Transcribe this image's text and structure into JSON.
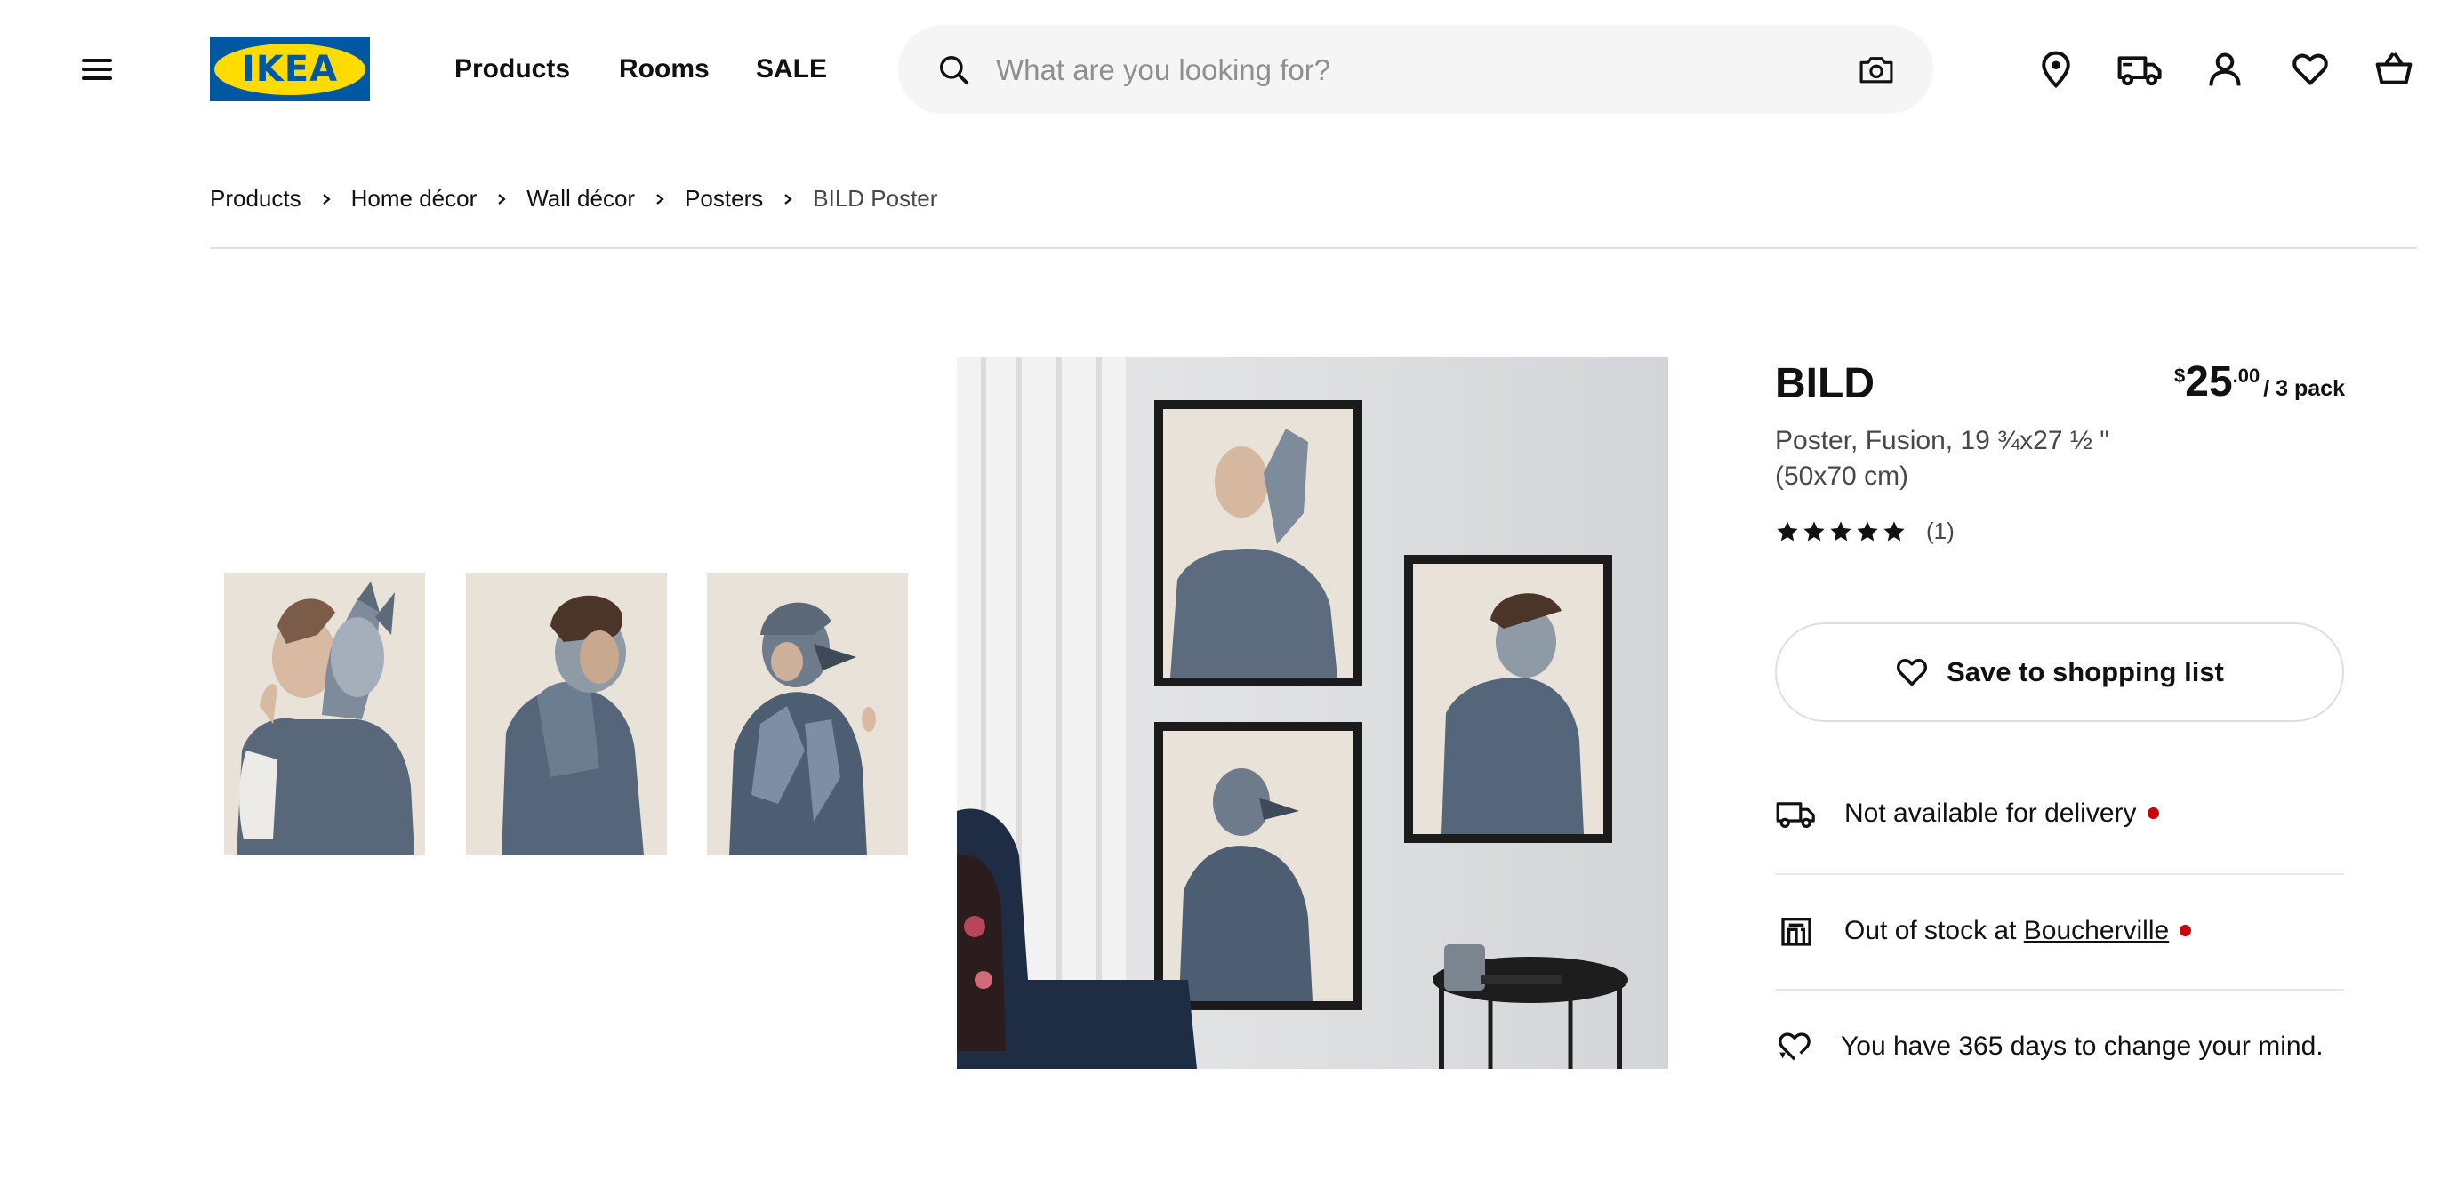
{
  "header": {
    "logo_text": "IKEA",
    "nav": [
      "Products",
      "Rooms",
      "SALE"
    ],
    "search_placeholder": "What are you looking for?",
    "icons": [
      "hamburger-menu-icon",
      "search-icon",
      "camera-icon",
      "location-pin-icon",
      "delivery-truck-icon",
      "user-icon",
      "heart-icon",
      "shopping-bag-icon"
    ]
  },
  "breadcrumb": [
    "Products",
    "Home décor",
    "Wall décor",
    "Posters",
    "BILD Poster"
  ],
  "gallery": {
    "thumbnails": [
      "fox-woman poster",
      "bear-man poster",
      "bird-woman poster"
    ]
  },
  "product": {
    "name": "BILD",
    "price": {
      "currency": "$",
      "integer": "25",
      "decimal": ".00",
      "unit": "/ 3 pack"
    },
    "description": "Poster, Fusion, 19 ¾x27 ½ \" (50x70 cm)",
    "rating": {
      "stars": 5,
      "count": "(1)"
    },
    "save_label": "Save to shopping list",
    "delivery": "Not available for delivery",
    "stock_prefix": "Out of stock at",
    "store": "Boucherville",
    "returns": "You have 365 days to change your mind."
  },
  "colors": {
    "brand_blue": "#0058a3",
    "brand_yellow": "#ffdb00",
    "status_red": "#cc0008",
    "text": "#111111",
    "muted": "#484848"
  }
}
